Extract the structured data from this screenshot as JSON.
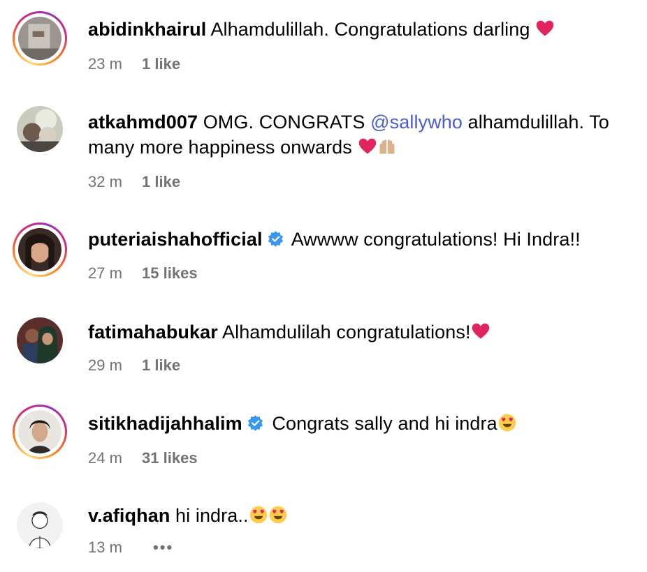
{
  "comments": [
    {
      "username": "abidinkhairul",
      "text": "Alhamdulillah. Congratulations darling",
      "emojis": [
        "red-heart"
      ],
      "time": "23 m",
      "likes": "1 like",
      "verified": false,
      "story_ring": true
    },
    {
      "username": "atkahmd007",
      "text_before": "OMG. CONGRATS",
      "mention": "@sallywho",
      "text_after": "alhamdulillah. To many more happiness onwards",
      "emojis": [
        "red-heart",
        "raised-hands"
      ],
      "time": "32 m",
      "likes": "1 like",
      "verified": false,
      "story_ring": false
    },
    {
      "username": "puteriaishahofficial",
      "text": "Awwww congratulations! Hi Indra!!",
      "emojis": [],
      "time": "27 m",
      "likes": "15 likes",
      "verified": true,
      "story_ring": true
    },
    {
      "username": "fatimahabukar",
      "text": "Alhamdulilah congratulations!",
      "emojis": [
        "red-heart"
      ],
      "time": "29 m",
      "likes": "1 like",
      "verified": false,
      "story_ring": false
    },
    {
      "username": "sitikhadijahhalim",
      "text": "Congrats sally and hi indra",
      "emojis": [
        "heart-eyes"
      ],
      "time": "24 m",
      "likes": "31 likes",
      "verified": true,
      "story_ring": true
    },
    {
      "username": "v.afiqhan",
      "text": "hi indra..",
      "emojis": [
        "heart-eyes",
        "heart-eyes"
      ],
      "time": "13 m",
      "more": "•••",
      "verified": false,
      "story_ring": false
    }
  ],
  "colors": {
    "mention": "#4a5bd9",
    "meta": "#737373",
    "verified": "#3897f0",
    "heart": "#e0245e"
  }
}
